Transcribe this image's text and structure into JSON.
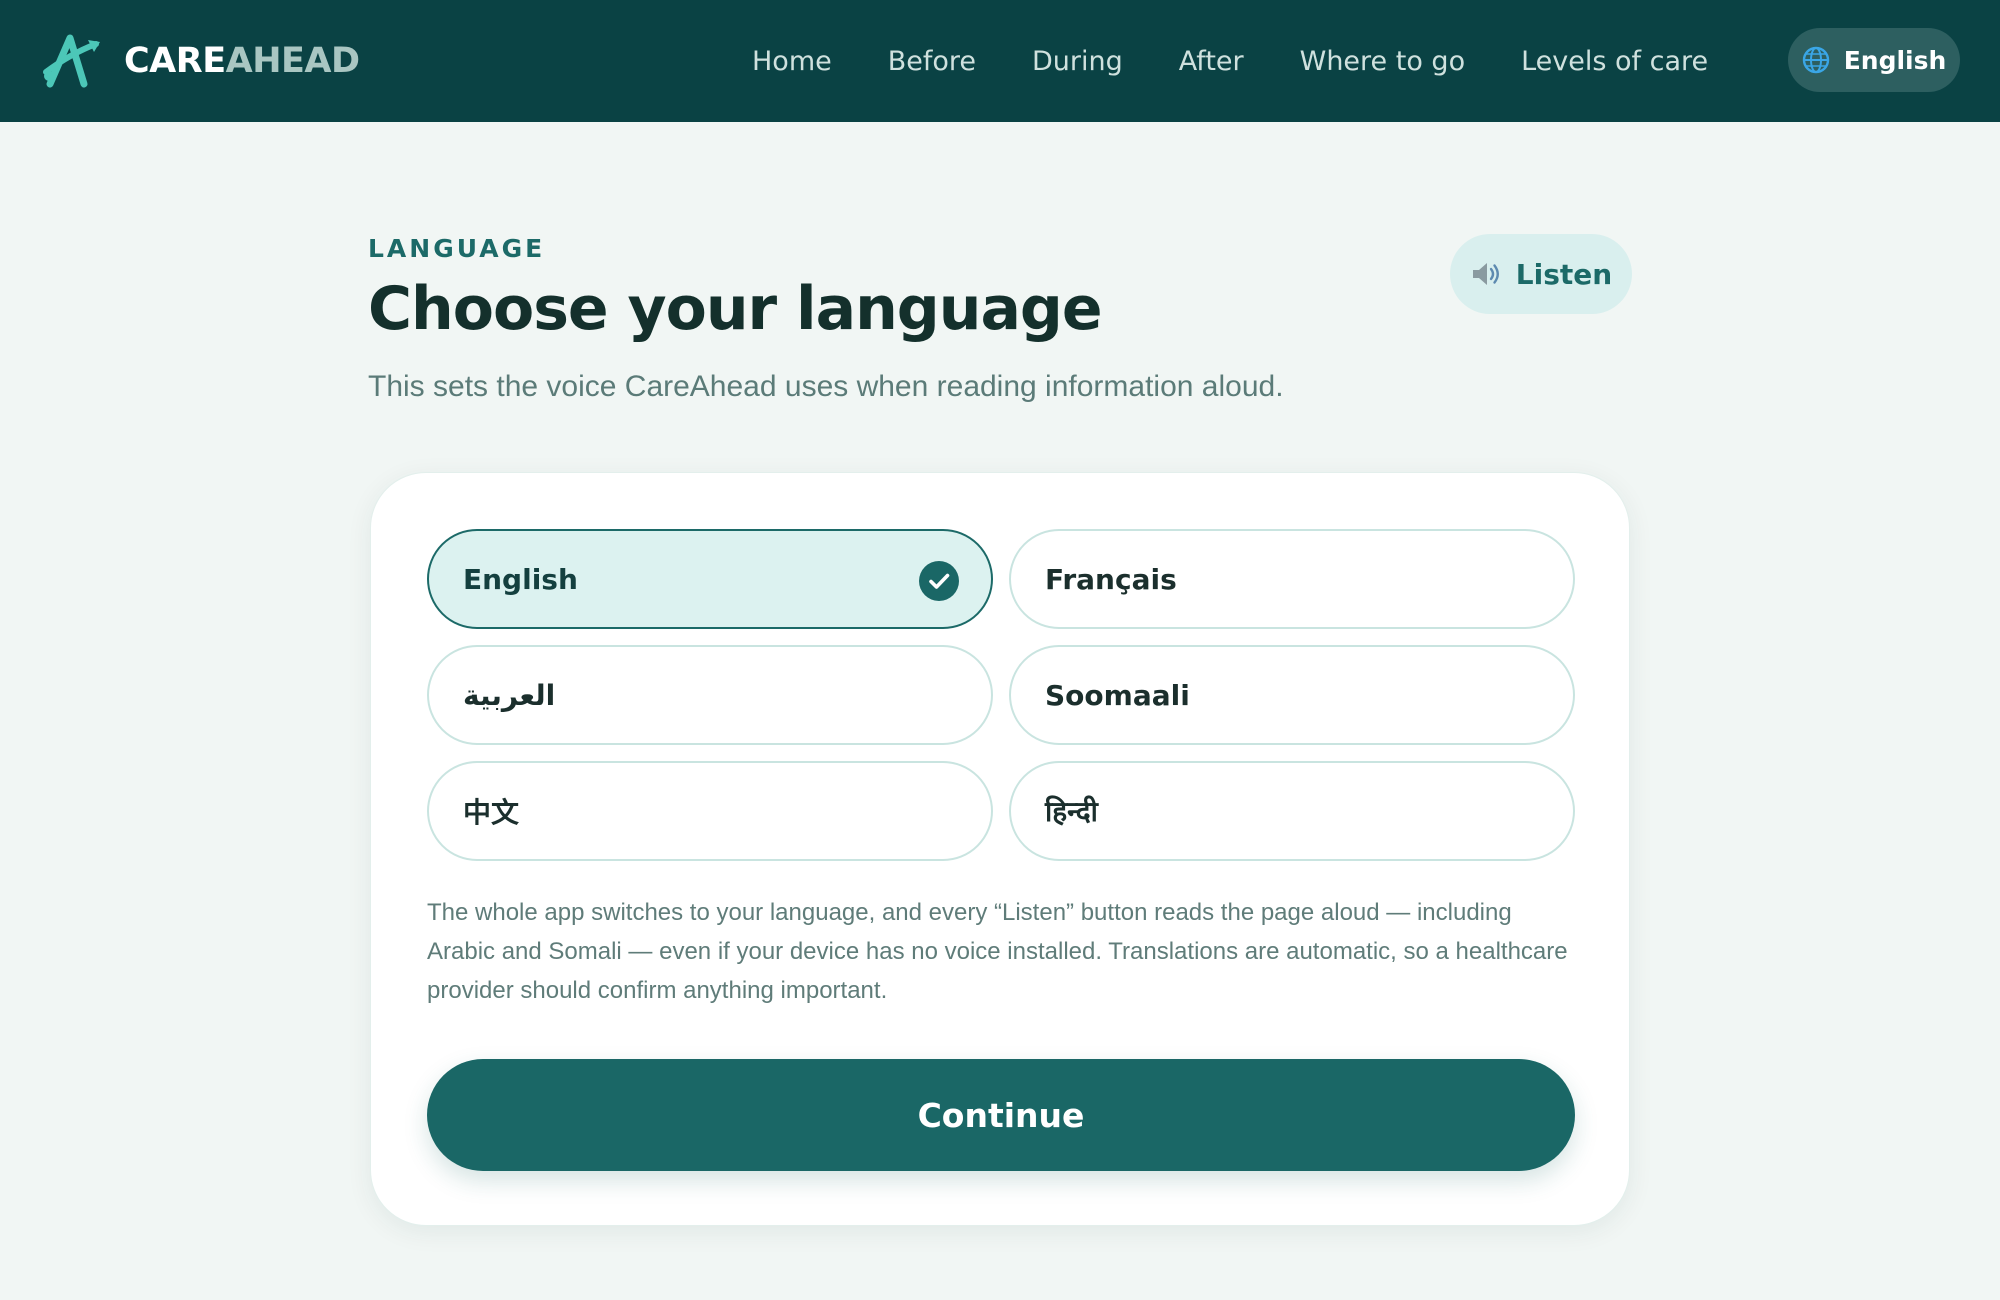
{
  "brand": {
    "care": "CARE",
    "ahead": "AHEAD",
    "logo_icon": "careahead-logo-icon"
  },
  "nav": {
    "items": [
      "Home",
      "Before",
      "During",
      "After",
      "Where to go",
      "Levels of care"
    ],
    "language_label": "English",
    "language_icon": "globe-icon"
  },
  "header": {
    "eyebrow": "LANGUAGE",
    "title": "Choose your language",
    "subtitle": "This sets the voice CareAhead uses when reading information aloud.",
    "listen_label": "Listen",
    "listen_icon": "speaker-icon"
  },
  "languages": {
    "options": [
      "English",
      "Français",
      "العربية",
      "Soomaali",
      "中文",
      "हिन्दी"
    ],
    "selected": "English"
  },
  "note": "The whole app switches to your language, and every “Listen” button reads the page aloud — including Arabic and Somali — even if your device has no voice installed. Translations are automatic, so a healthcare provider should confirm anything important.",
  "continue_label": "Continue",
  "colors": {
    "topbar": "#0a4244",
    "accent": "#1a6766",
    "selected_bg": "#dcf2f0",
    "page_bg": "#f1f6f4"
  }
}
